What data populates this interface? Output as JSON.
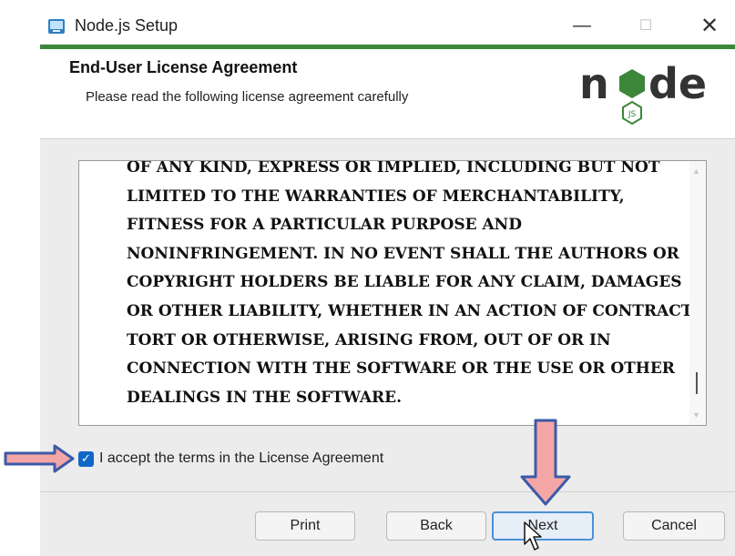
{
  "window": {
    "title": "Node.js Setup",
    "controls": {
      "minimize": "—",
      "maximize": "☐",
      "close": "✕"
    }
  },
  "header": {
    "title": "End-User License Agreement",
    "subtitle": "Please read the following license agreement carefully",
    "logo_text": "node",
    "logo_badge": "JS"
  },
  "license": {
    "text": "OF ANY KIND, EXPRESS OR IMPLIED, INCLUDING BUT NOT\nLIMITED TO THE WARRANTIES OF MERCHANTABILITY,\nFITNESS FOR A PARTICULAR PURPOSE AND\nNONINFRINGEMENT. IN NO EVENT SHALL THE AUTHORS OR\nCOPYRIGHT HOLDERS BE LIABLE FOR ANY CLAIM, DAMAGES\nOR OTHER LIABILITY, WHETHER IN AN ACTION OF CONTRACT,\nTORT OR OTHERWISE, ARISING FROM, OUT OF OR IN\nCONNECTION WITH THE SOFTWARE OR THE USE OR OTHER\nDEALINGS IN THE SOFTWARE."
  },
  "accept": {
    "label": "I accept the terms in the License Agreement",
    "checked": true,
    "check_glyph": "✓"
  },
  "buttons": {
    "print": "Print",
    "back": "Back",
    "next": "Next",
    "cancel": "Cancel"
  },
  "colors": {
    "accent_green": "#3c873a",
    "checkbox_blue": "#1167c8",
    "arrow_fill": "#f4a6a6",
    "arrow_stroke": "#3b5aa8"
  }
}
